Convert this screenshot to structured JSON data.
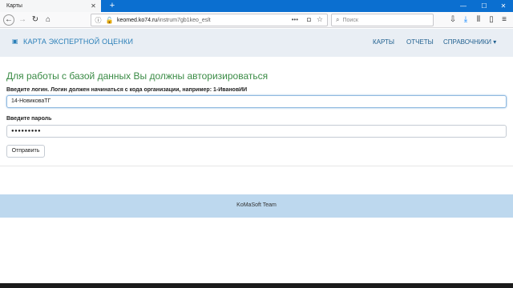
{
  "browser": {
    "tab_title": "Карты",
    "url_host": "keomed.ko74.ru",
    "url_path": "/instrum7gb1keo_eslt",
    "search_placeholder": "Поиск"
  },
  "navbar": {
    "brand": "КАРТА ЭКСПЕРТНОЙ ОЦЕНКИ",
    "links": [
      "КАРТЫ",
      "ОТЧЕТЫ",
      "СПРАВОЧНИКИ ▾"
    ]
  },
  "page": {
    "heading": "Для работы с базой данных Вы должны авторизироваться",
    "login_label": "Введите логин. Логин должен начинаться с кода организации, например: 1-ИвановИИ",
    "login_value": "14-НовиковаТГ",
    "password_label": "Введите пароль",
    "password_value": "●●●●●●●●●",
    "submit_label": "Отправить"
  },
  "footer": {
    "text": "KoMaSoft Team"
  },
  "colors": {
    "titlebar": "#0b6fd0",
    "navbar": "#e9eef4",
    "brand": "#2a7fb8",
    "heading": "#3a8b45",
    "footer": "#bdd8ee"
  }
}
